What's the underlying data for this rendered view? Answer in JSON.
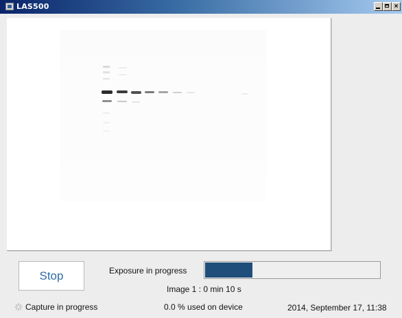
{
  "window": {
    "title": "LAS500",
    "minimize_icon": "minimize-icon",
    "maximize_icon": "maximize-icon",
    "close_icon": "close-icon",
    "close_glyph": "×"
  },
  "controls": {
    "stop_label": "Stop",
    "exposure_label": "Exposure in progress",
    "progress_fraction": 0.27,
    "progress_color": "#1f4e7a",
    "image_time": "Image 1 : 0 min 10 s"
  },
  "status": {
    "activity_icon": "spinner-icon",
    "left": "Capture in progress",
    "middle": "0.0 % used on device",
    "right": "2014, September 17, 11:38"
  }
}
